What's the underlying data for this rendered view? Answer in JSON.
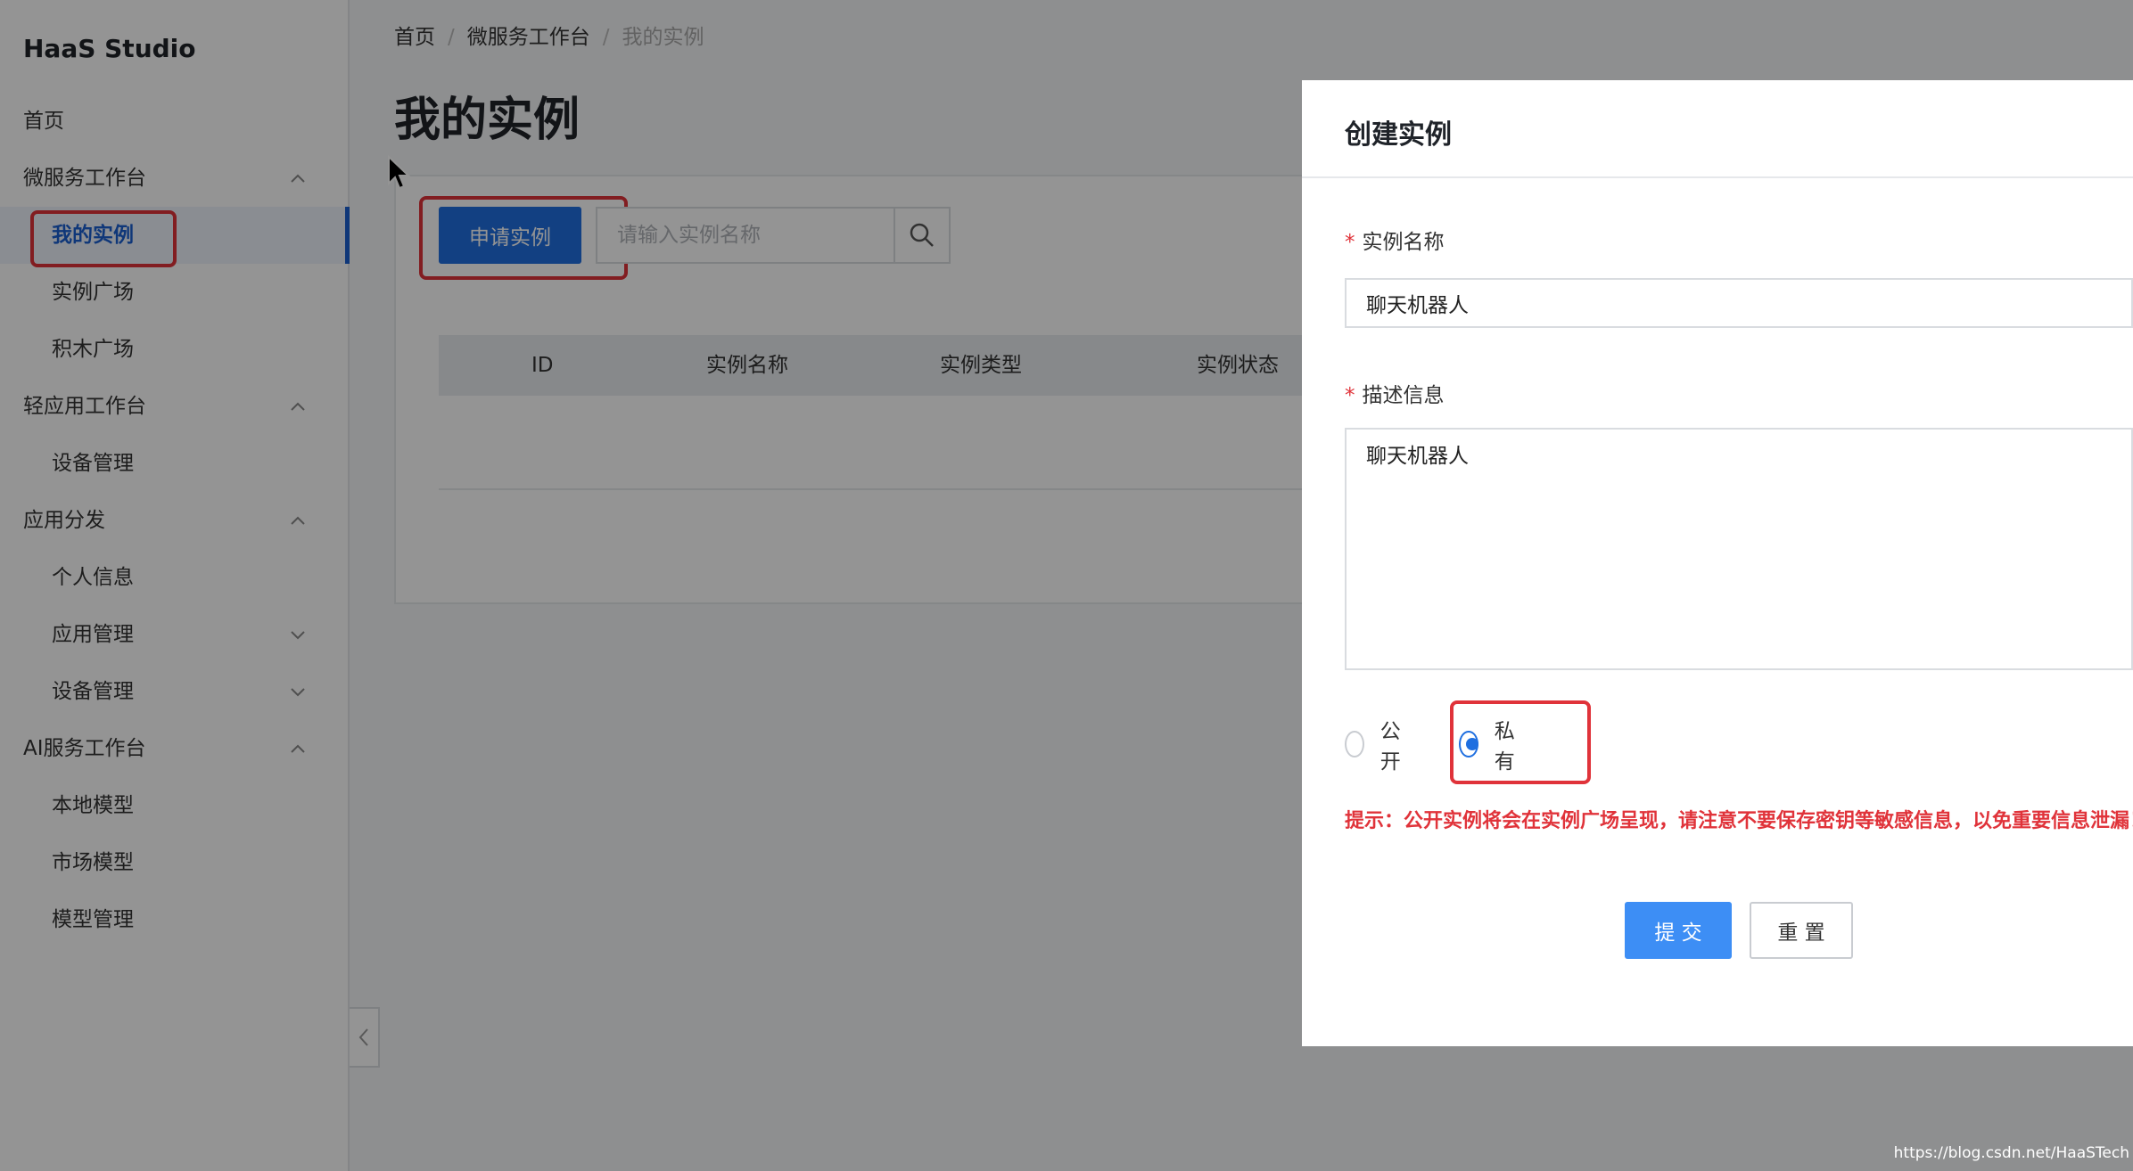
{
  "app": {
    "title": "HaaS Studio"
  },
  "sidebar": {
    "items": [
      {
        "label": "首页",
        "level": 0
      },
      {
        "label": "微服务工作台",
        "level": 0,
        "chevron": "chevron-up-icon"
      },
      {
        "label": "我的实例",
        "level": 1,
        "active": true
      },
      {
        "label": "实例广场",
        "level": 1
      },
      {
        "label": "积木广场",
        "level": 1
      },
      {
        "label": "轻应用工作台",
        "level": 0,
        "chevron": "chevron-up-icon"
      },
      {
        "label": "设备管理",
        "level": 1
      },
      {
        "label": "应用分发",
        "level": 0,
        "chevron": "chevron-up-icon"
      },
      {
        "label": "个人信息",
        "level": 1
      },
      {
        "label": "应用管理",
        "level": 1,
        "chevron": "chevron-down-icon"
      },
      {
        "label": "设备管理",
        "level": 1,
        "chevron": "chevron-down-icon"
      },
      {
        "label": "AI服务工作台",
        "level": 0,
        "chevron": "chevron-up-icon"
      },
      {
        "label": "本地模型",
        "level": 1
      },
      {
        "label": "市场模型",
        "level": 1
      },
      {
        "label": "模型管理",
        "level": 1
      }
    ],
    "collapse_icon": "chevron-left-icon"
  },
  "breadcrumb": {
    "home": "首页",
    "section": "微服务工作台",
    "current": "我的实例",
    "separator": "/"
  },
  "main": {
    "title": "我的实例",
    "apply_button": "申请实例",
    "search": {
      "placeholder": "请输入实例名称",
      "value": "",
      "icon": "search-icon"
    },
    "table": {
      "columns": [
        "ID",
        "实例名称",
        "实例类型",
        "实例状态"
      ]
    }
  },
  "drawer": {
    "title": "创建实例",
    "required_mark": "*",
    "name_field": {
      "label": "实例名称",
      "value": "聊天机器人"
    },
    "desc_field": {
      "label": "描述信息",
      "value": "聊天机器人"
    },
    "visibility": {
      "options": [
        "公开",
        "私有"
      ],
      "selected": "私有"
    },
    "hint": "提示：公开实例将会在实例广场呈现，请注意不要保存密钥等敏感信息，以免重要信息泄漏！",
    "submit_button": "提 交",
    "reset_button": "重 置"
  },
  "watermark": "https://blog.csdn.net/HaaSTech",
  "colors": {
    "primary": "#1f6fe0",
    "highlight": "#e0333a",
    "submit": "#3d8ef5"
  }
}
